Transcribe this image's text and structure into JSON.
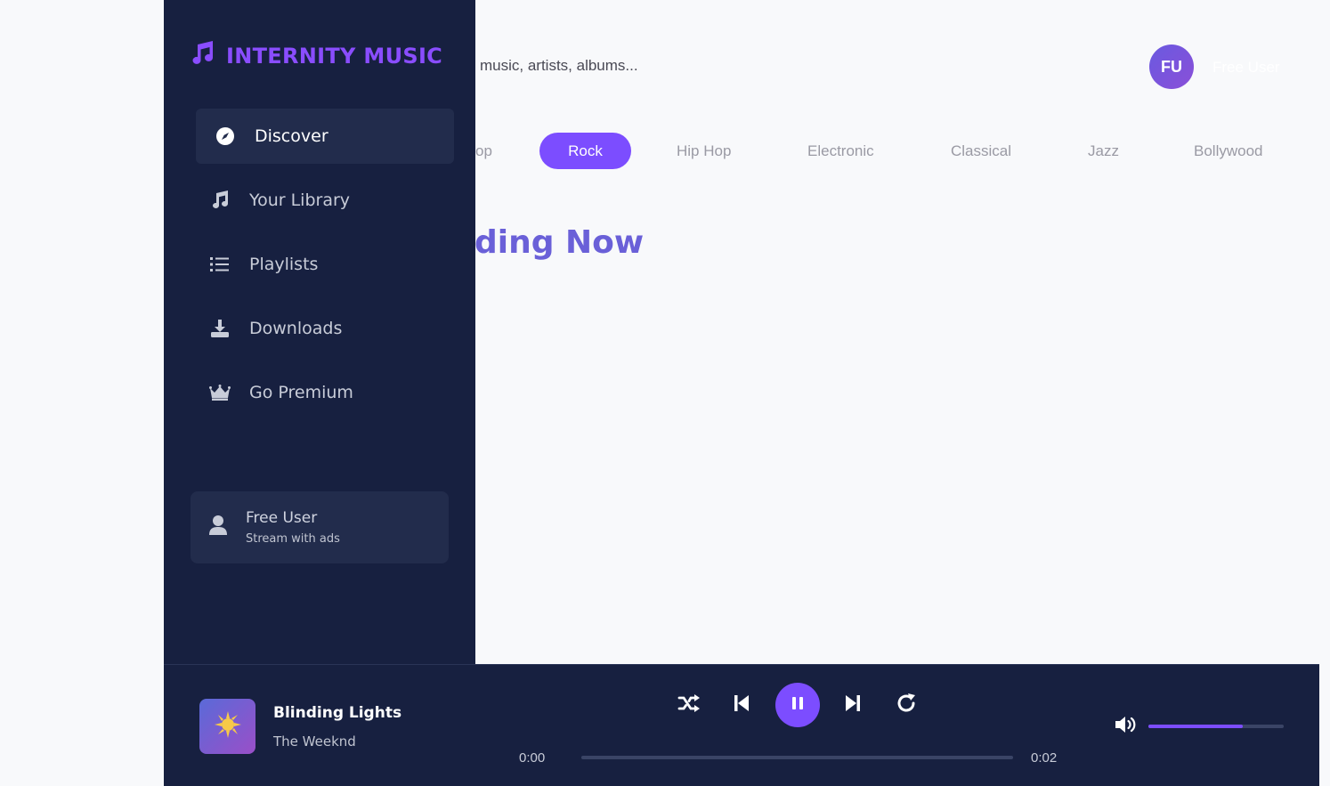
{
  "app": {
    "name": "INTERNITY MUSIC"
  },
  "search": {
    "placeholder": "music, artists, albums..."
  },
  "header": {
    "avatar_initials": "FU",
    "user_name": "Free User"
  },
  "genres": {
    "items": [
      "op",
      "Rock",
      "Hip Hop",
      "Electronic",
      "Classical",
      "Jazz",
      "Bollywood"
    ],
    "active": "Rock"
  },
  "main": {
    "section_title": "ding Now"
  },
  "sidebar": {
    "items": [
      {
        "label": "Discover",
        "icon": "compass-icon"
      },
      {
        "label": "Your Library",
        "icon": "music-note-icon"
      },
      {
        "label": "Playlists",
        "icon": "list-icon"
      },
      {
        "label": "Downloads",
        "icon": "download-icon"
      },
      {
        "label": "Go Premium",
        "icon": "crown-icon"
      }
    ],
    "active": "Discover",
    "user_card": {
      "name": "Free User",
      "subtitle": "Stream with ads"
    }
  },
  "player": {
    "track_title": "Blinding Lights",
    "artist": "The Weeknd",
    "current_time": "0:00",
    "duration": "0:02",
    "progress": 0,
    "volume": 0.7,
    "state": "playing"
  },
  "colors": {
    "accent": "#7c4dff",
    "sidebar_bg": "#172040",
    "title": "#6a60d8"
  }
}
